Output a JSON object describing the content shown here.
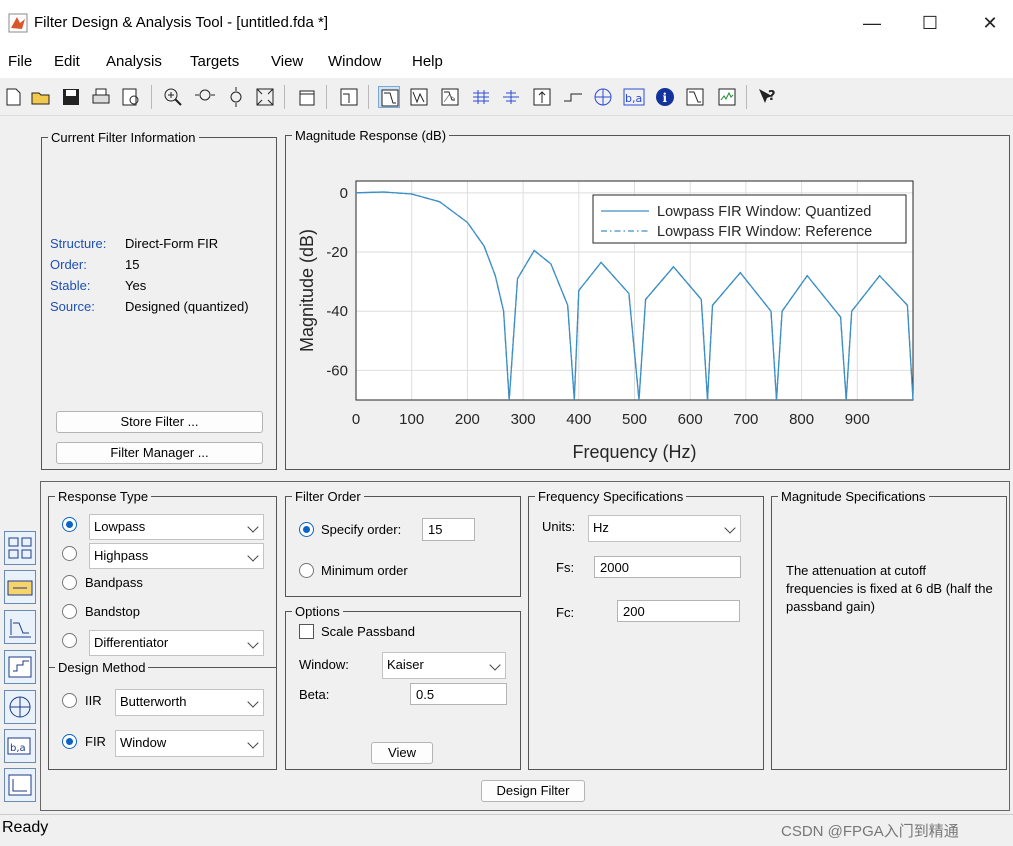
{
  "window": {
    "title": "Filter Design & Analysis Tool -  [untitled.fda *]",
    "minimize": "—",
    "maximize": "☐",
    "close": "✕"
  },
  "menu": [
    "File",
    "Edit",
    "Analysis",
    "Targets",
    "View",
    "Window",
    "Help"
  ],
  "toolbar_icons": [
    "new-icon",
    "open-icon",
    "save-icon",
    "print-icon",
    "print-preview-icon",
    "zoom-in-icon",
    "zoom-x-icon",
    "zoom-y-icon",
    "full-view-icon",
    "new-figure-icon",
    "filter-specs-icon",
    "magnitude-response-icon",
    "phase-response-icon",
    "magnitude-phase-icon",
    "group-delay-icon",
    "phase-delay-icon",
    "impulse-response-icon",
    "step-response-icon",
    "pole-zero-icon",
    "filter-coefficients-icon",
    "filter-info-icon",
    "magnitude-estimate-icon",
    "round-off-noise-icon",
    "whats-this-icon"
  ],
  "current_filter": {
    "legend": "Current Filter Information",
    "rows": [
      {
        "label": "Structure:",
        "value": "Direct-Form FIR"
      },
      {
        "label": "Order:",
        "value": "15"
      },
      {
        "label": "Stable:",
        "value": "Yes"
      },
      {
        "label": "Source:",
        "value": "Designed (quantized)"
      }
    ],
    "store_button": "Store Filter ...",
    "manager_button": "Filter Manager ..."
  },
  "magnitude_panel": {
    "legend": "Magnitude Response (dB)"
  },
  "chart_data": {
    "type": "line",
    "title": "",
    "xlabel": "Frequency (Hz)",
    "ylabel": "Magnitude (dB)",
    "xlim": [
      0,
      1000
    ],
    "ylim": [
      -70,
      4
    ],
    "xticks": [
      0,
      100,
      200,
      300,
      400,
      500,
      600,
      700,
      800,
      900
    ],
    "yticks": [
      0,
      -20,
      -40,
      -60
    ],
    "grid": true,
    "legend_position": "top-right",
    "x": [
      0,
      50,
      100,
      150,
      200,
      230,
      250,
      265,
      275,
      290,
      320,
      350,
      380,
      392,
      400,
      440,
      490,
      508,
      520,
      570,
      620,
      631,
      640,
      690,
      745,
      755,
      765,
      810,
      870,
      880,
      890,
      940,
      990,
      1000
    ],
    "series": [
      {
        "name": "Lowpass FIR Window: Quantized",
        "style": "solid",
        "values": [
          0,
          0.3,
          -0.4,
          -3,
          -10,
          -18,
          -28,
          -40,
          -70,
          -29,
          -19.5,
          -24,
          -38,
          -70,
          -33,
          -23.5,
          -34,
          -70,
          -36,
          -25,
          -36,
          -70,
          -38,
          -27,
          -40,
          -70,
          -40,
          -28,
          -42,
          -70,
          -40,
          -28,
          -38,
          -70
        ]
      },
      {
        "name": "Lowpass FIR Window: Reference",
        "style": "dash-dot",
        "values": [
          0,
          0.3,
          -0.4,
          -3,
          -10,
          -18,
          -28,
          -40,
          -70,
          -29,
          -19.5,
          -24,
          -38,
          -70,
          -33,
          -23.5,
          -34,
          -70,
          -36,
          -25,
          -36,
          -70,
          -38,
          -27,
          -40,
          -70,
          -40,
          -28,
          -42,
          -70,
          -40,
          -28,
          -38,
          -70
        ]
      }
    ]
  },
  "response_type": {
    "legend": "Response Type",
    "options": [
      {
        "label": "Lowpass",
        "kind": "combo",
        "selected": true
      },
      {
        "label": "Highpass",
        "kind": "combo",
        "selected": false
      },
      {
        "label": "Bandpass",
        "kind": "radio",
        "selected": false
      },
      {
        "label": "Bandstop",
        "kind": "radio",
        "selected": false
      },
      {
        "label": "Differentiator",
        "kind": "combo",
        "selected": false
      }
    ]
  },
  "design_method": {
    "legend": "Design Method",
    "iir_label": "IIR",
    "iir_value": "Butterworth",
    "fir_label": "FIR",
    "fir_value": "Window",
    "selected": "FIR"
  },
  "filter_order": {
    "legend": "Filter Order",
    "specify_label": "Specify order:",
    "specify_value": "15",
    "minimum_label": "Minimum order"
  },
  "options": {
    "legend": "Options",
    "scale_passband": "Scale Passband",
    "window_label": "Window:",
    "window_value": "Kaiser",
    "beta_label": "Beta:",
    "beta_value": "0.5",
    "view_button": "View"
  },
  "frequency_specs": {
    "legend": "Frequency Specifications",
    "units_label": "Units:",
    "units_value": "Hz",
    "fs_label": "Fs:",
    "fs_value": "2000",
    "fc_label": "Fc:",
    "fc_value": "200"
  },
  "magnitude_specs": {
    "legend": "Magnitude Specifications",
    "text": "The attenuation at cutoff frequencies is fixed at 6 dB (half the passband gain)"
  },
  "design_button": "Design Filter",
  "status": "Ready",
  "watermark": "CSDN @FPGA入门到精通",
  "colors": {
    "line": "#3d8fc4",
    "label_blue": "#1e50b4",
    "radio_on": "#0a64c8"
  }
}
